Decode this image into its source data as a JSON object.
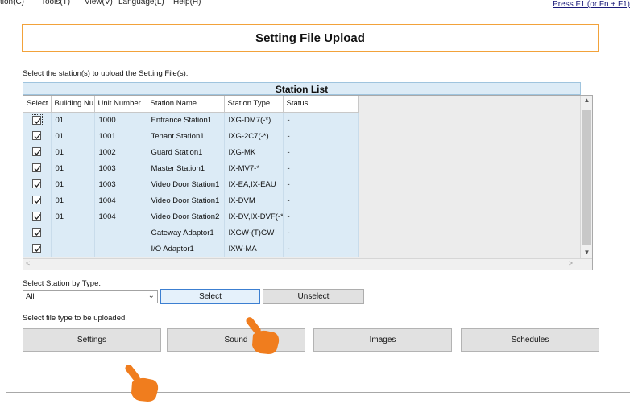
{
  "menu": {
    "items": [
      "tion(C)",
      "Tools(T)",
      "View(V)",
      "Language(L)",
      "Help(H)"
    ],
    "help_hint": "Press F1 (or Fn + F1)"
  },
  "title": "Setting File Upload",
  "prompt_select_station": "Select the station(s) to upload the Setting File(s):",
  "station_list": {
    "title": "Station List",
    "columns": [
      "Select",
      "Building Nu",
      "Unit Number",
      "Station Name",
      "Station Type",
      "Status"
    ],
    "rows": [
      {
        "selected": true,
        "building": "01",
        "unit": "1000",
        "name": "Entrance Station1",
        "type": "IXG-DM7(-*)",
        "status": "-"
      },
      {
        "selected": true,
        "building": "01",
        "unit": "1001",
        "name": "Tenant Station1",
        "type": "IXG-2C7(-*)",
        "status": "-"
      },
      {
        "selected": true,
        "building": "01",
        "unit": "1002",
        "name": "Guard Station1",
        "type": "IXG-MK",
        "status": "-"
      },
      {
        "selected": true,
        "building": "01",
        "unit": "1003",
        "name": "Master Station1",
        "type": "IX-MV7-*",
        "status": "-"
      },
      {
        "selected": true,
        "building": "01",
        "unit": "1003",
        "name": "Video Door Station1",
        "type": "IX-EA,IX-EAU",
        "status": "-"
      },
      {
        "selected": true,
        "building": "01",
        "unit": "1004",
        "name": "Video Door Station1",
        "type": "IX-DVM",
        "status": "-"
      },
      {
        "selected": true,
        "building": "01",
        "unit": "1004",
        "name": "Video Door Station2",
        "type": "IX-DV,IX-DVF(-*)",
        "status": "-"
      },
      {
        "selected": true,
        "building": "",
        "unit": "",
        "name": "Gateway Adaptor1",
        "type": "IXGW-(T)GW",
        "status": "-"
      },
      {
        "selected": true,
        "building": "",
        "unit": "",
        "name": "I/O Adaptor1",
        "type": "IXW-MA",
        "status": "-"
      }
    ]
  },
  "select_by_type": {
    "label": "Select Station by Type.",
    "selected_value": "All",
    "select_button": "Select",
    "unselect_button": "Unselect"
  },
  "file_type": {
    "label": "Select file type to be uploaded.",
    "buttons": [
      "Settings",
      "Sound",
      "Images",
      "Schedules"
    ]
  },
  "colors": {
    "accent_border": "#f2a23a",
    "row_background": "#dcebf6",
    "focus_blue": "#3c7fd1",
    "pointer_orange": "#f07d1e"
  },
  "icons": {
    "checkbox": "checkmark-icon",
    "dropdown": "chevron-down-icon",
    "pointer": "pointing-hand-icon"
  }
}
